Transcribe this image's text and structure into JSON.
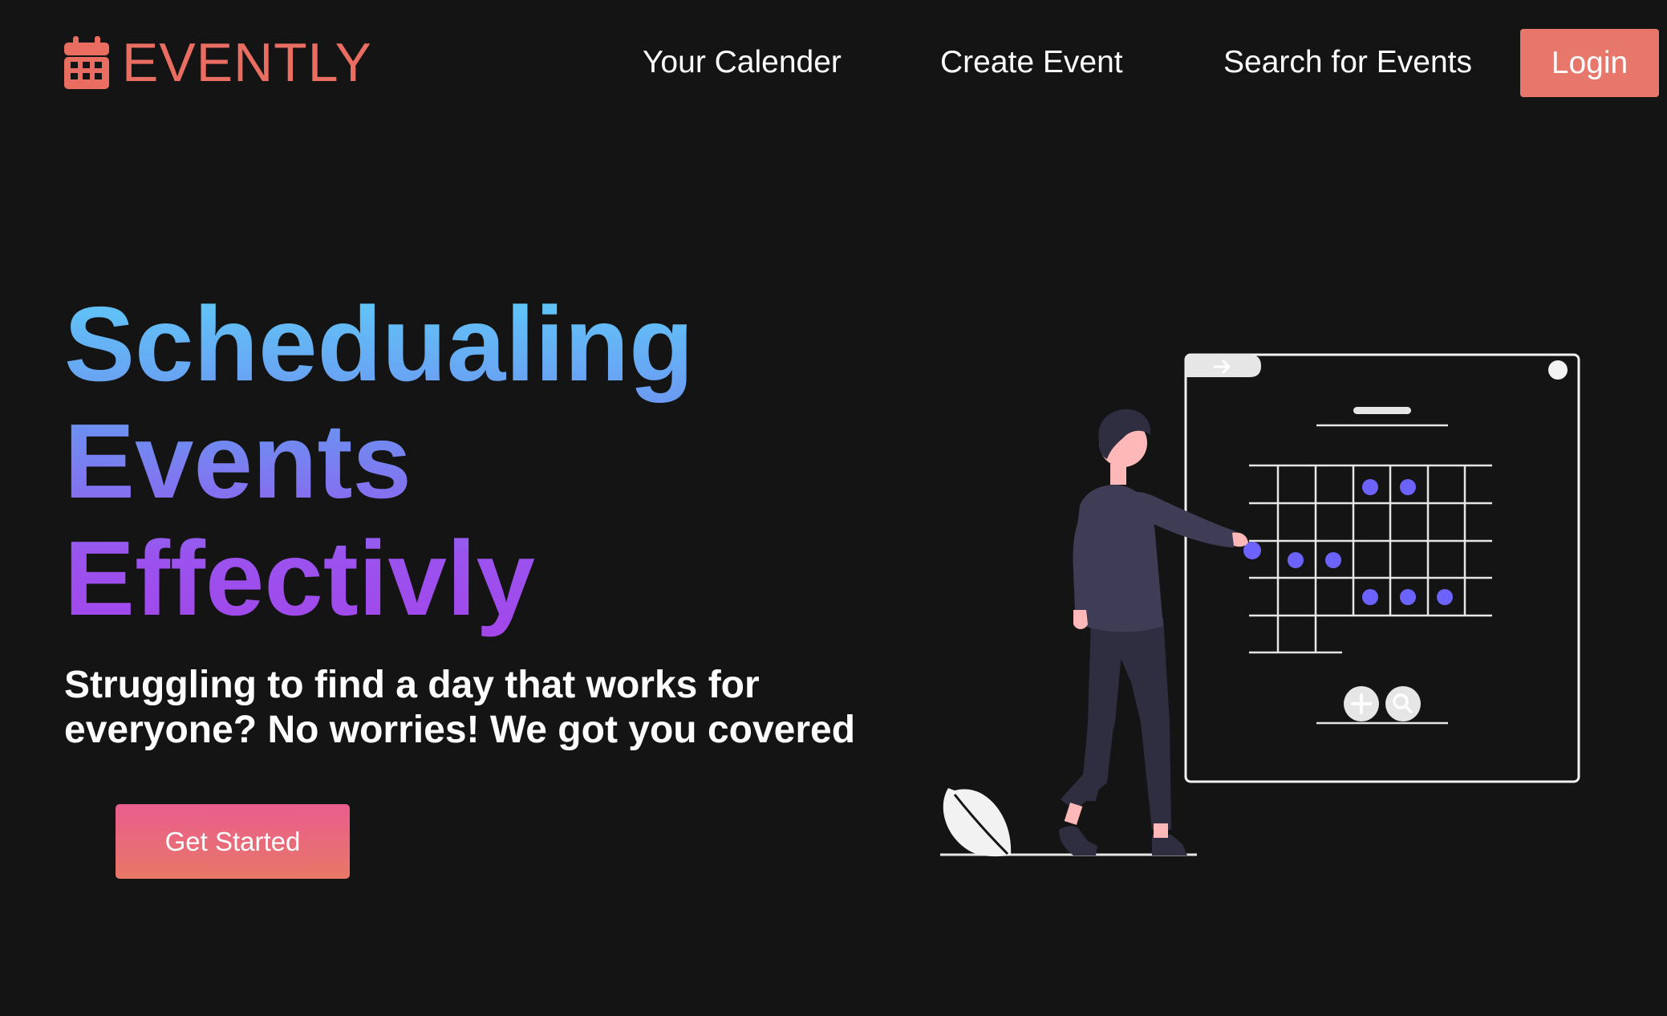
{
  "brand": {
    "name": "EVENTLY",
    "icon": "calendar-icon",
    "color": "#ea6d62"
  },
  "nav": {
    "links": [
      {
        "label": "Your Calender"
      },
      {
        "label": "Create Event"
      },
      {
        "label": "Search for Events"
      }
    ],
    "login_label": "Login",
    "login_color": "#e8776b"
  },
  "hero": {
    "title_lines": [
      "Schedualing",
      "Events",
      "Effectivly"
    ],
    "title_gradient": [
      "#5ecbf7",
      "#6f8df1",
      "#9b52ee",
      "#a346ea"
    ],
    "subtitle": "Struggling to find a day that works for everyone? No worries! We got you covered",
    "cta_label": "Get Started",
    "cta_gradient": [
      "#e95d8d",
      "#e87868"
    ]
  },
  "illustration": {
    "accent_color": "#6c63ff",
    "icons": [
      "arrow-right-icon",
      "plus-icon",
      "search-icon"
    ]
  },
  "colors": {
    "background": "#141414",
    "text": "#ffffff"
  }
}
